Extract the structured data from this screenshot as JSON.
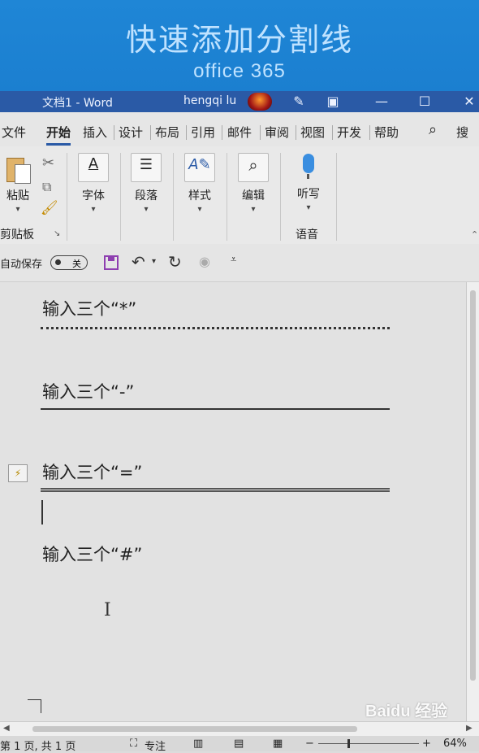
{
  "banner": {
    "title": "快速添加分割线",
    "subtitle": "office 365"
  },
  "titlebar": {
    "doc_title": "文档1  -  Word",
    "user": "hengqi lu",
    "pen_icon": "pen-icon",
    "ribbon_icon": "ribbon-display-icon",
    "minimize": "—",
    "maximize": "☐",
    "close": "✕"
  },
  "tabs": [
    "文件",
    "开始",
    "插入",
    "设计",
    "布局",
    "引用",
    "邮件",
    "审阅",
    "视图",
    "开发",
    "帮助"
  ],
  "active_tab": "开始",
  "search_label": "搜",
  "ribbon": {
    "paste_label": "粘贴",
    "clipboard_group": "剪贴板",
    "font_label": "字体",
    "paragraph_label": "段落",
    "styles_label": "样式",
    "editing_label": "编辑",
    "dictate_label": "听写",
    "voice_group": "语音"
  },
  "qat": {
    "autosave_label": "自动保存",
    "autosave_state": "关"
  },
  "document": {
    "line1": "输入三个“*”",
    "line2": "输入三个“-”",
    "line3": "输入三个“=”",
    "line4": "输入三个“#”"
  },
  "status": {
    "page": "第 1 页, 共 1 页",
    "focus": "专注",
    "zoom": "64%",
    "zoom_minus": "−",
    "zoom_plus": "+"
  },
  "watermark": "Baidu 经验",
  "colors": {
    "banner": "#1f86d6",
    "titlebar": "#2a5aa6",
    "qat_save": "#8e3fb0"
  }
}
